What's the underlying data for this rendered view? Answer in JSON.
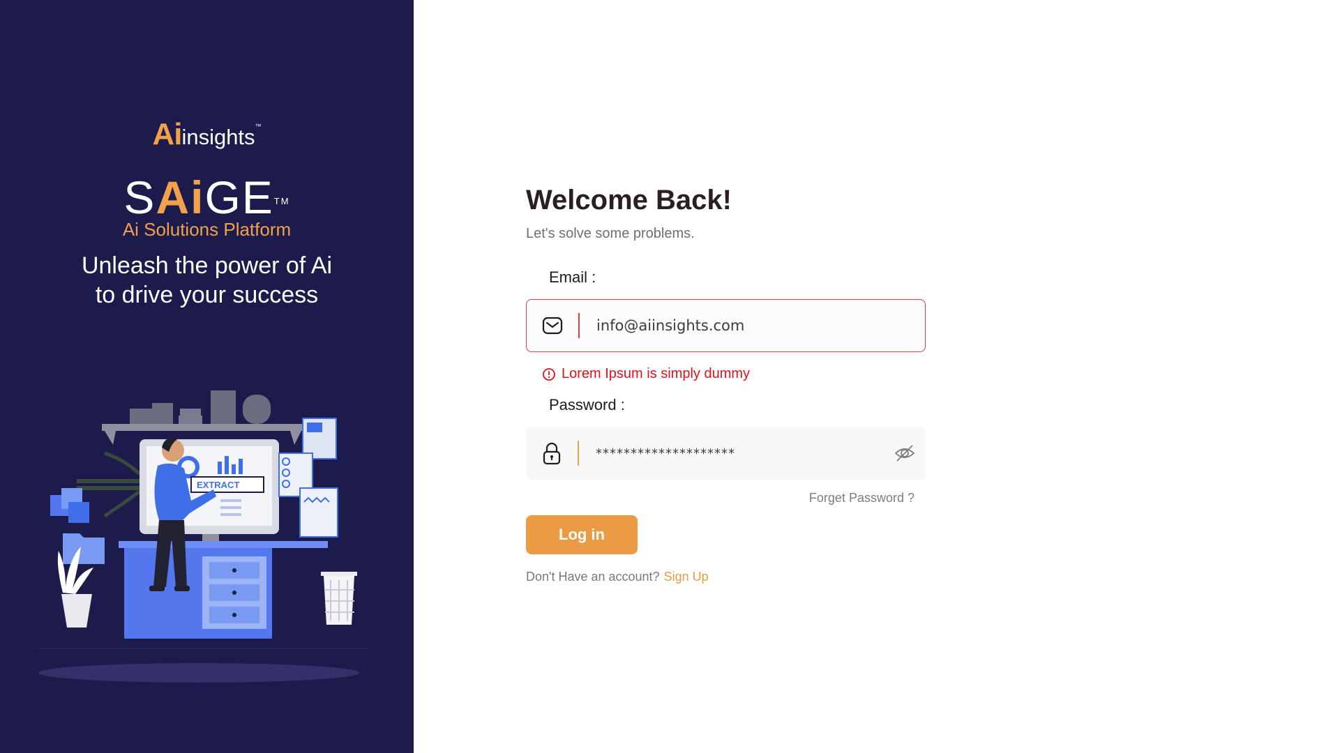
{
  "brand": {
    "logo_ai": "Ai",
    "logo_rest": "insights",
    "logo_tm": "™"
  },
  "product": {
    "name_s": "S",
    "name_ai": "Ai",
    "name_ge": "GE",
    "name_tm": "TM",
    "subtitle": "Ai Solutions Platform"
  },
  "tagline": {
    "line1": "Unleash the power of Ai",
    "line2": "to drive your success"
  },
  "illustration": {
    "screen_label": "EXTRACT"
  },
  "form": {
    "title": "Welcome Back!",
    "subtitle": "Let's solve some problems.",
    "email_label": "Email :",
    "email_value": "info@aiinsights.com",
    "email_error": "Lorem Ipsum is simply dummy",
    "password_label": "Password :",
    "password_value": "********************",
    "forgot_label": "Forget Password ?",
    "login_label": "Log in",
    "no_account_text": "Don't Have an account?",
    "signup_label": "Sign Up"
  },
  "colors": {
    "panel_bg": "#1d1b4c",
    "accent": "#eb9b43",
    "error": "#e2101e",
    "title": "#2a1e1e"
  },
  "icons": {
    "email": "mail-icon",
    "password": "lock-icon",
    "toggle": "eye-off-icon",
    "error": "alert-circle-icon"
  }
}
